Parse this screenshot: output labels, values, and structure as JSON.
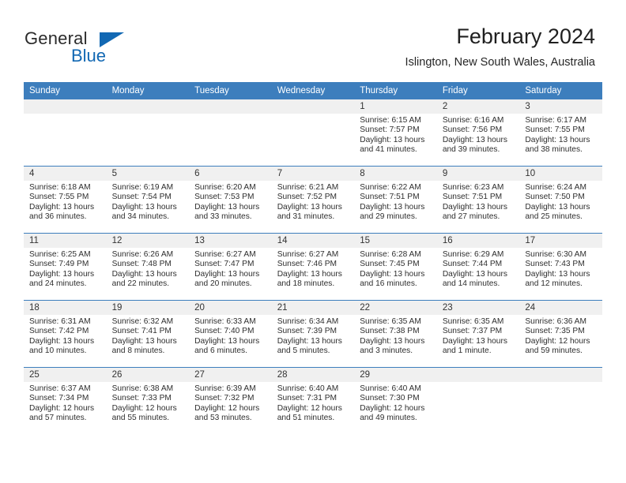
{
  "brand": {
    "name_part1": "General",
    "name_part2": "Blue",
    "accent_color": "#1268b3"
  },
  "header": {
    "title": "February 2024",
    "location": "Islington, New South Wales, Australia"
  },
  "theme": {
    "header_row_bg": "#3d7ebd",
    "daynum_bg": "#f0f0f0",
    "grid_line": "#3d7ebd"
  },
  "weekday_headers": [
    "Sunday",
    "Monday",
    "Tuesday",
    "Wednesday",
    "Thursday",
    "Friday",
    "Saturday"
  ],
  "weeks": [
    [
      {
        "day": "",
        "sunrise": "",
        "sunset": "",
        "daylight": "",
        "daylight2": ""
      },
      {
        "day": "",
        "sunrise": "",
        "sunset": "",
        "daylight": "",
        "daylight2": ""
      },
      {
        "day": "",
        "sunrise": "",
        "sunset": "",
        "daylight": "",
        "daylight2": ""
      },
      {
        "day": "",
        "sunrise": "",
        "sunset": "",
        "daylight": "",
        "daylight2": ""
      },
      {
        "day": "1",
        "sunrise": "Sunrise: 6:15 AM",
        "sunset": "Sunset: 7:57 PM",
        "daylight": "Daylight: 13 hours",
        "daylight2": "and 41 minutes."
      },
      {
        "day": "2",
        "sunrise": "Sunrise: 6:16 AM",
        "sunset": "Sunset: 7:56 PM",
        "daylight": "Daylight: 13 hours",
        "daylight2": "and 39 minutes."
      },
      {
        "day": "3",
        "sunrise": "Sunrise: 6:17 AM",
        "sunset": "Sunset: 7:55 PM",
        "daylight": "Daylight: 13 hours",
        "daylight2": "and 38 minutes."
      }
    ],
    [
      {
        "day": "4",
        "sunrise": "Sunrise: 6:18 AM",
        "sunset": "Sunset: 7:55 PM",
        "daylight": "Daylight: 13 hours",
        "daylight2": "and 36 minutes."
      },
      {
        "day": "5",
        "sunrise": "Sunrise: 6:19 AM",
        "sunset": "Sunset: 7:54 PM",
        "daylight": "Daylight: 13 hours",
        "daylight2": "and 34 minutes."
      },
      {
        "day": "6",
        "sunrise": "Sunrise: 6:20 AM",
        "sunset": "Sunset: 7:53 PM",
        "daylight": "Daylight: 13 hours",
        "daylight2": "and 33 minutes."
      },
      {
        "day": "7",
        "sunrise": "Sunrise: 6:21 AM",
        "sunset": "Sunset: 7:52 PM",
        "daylight": "Daylight: 13 hours",
        "daylight2": "and 31 minutes."
      },
      {
        "day": "8",
        "sunrise": "Sunrise: 6:22 AM",
        "sunset": "Sunset: 7:51 PM",
        "daylight": "Daylight: 13 hours",
        "daylight2": "and 29 minutes."
      },
      {
        "day": "9",
        "sunrise": "Sunrise: 6:23 AM",
        "sunset": "Sunset: 7:51 PM",
        "daylight": "Daylight: 13 hours",
        "daylight2": "and 27 minutes."
      },
      {
        "day": "10",
        "sunrise": "Sunrise: 6:24 AM",
        "sunset": "Sunset: 7:50 PM",
        "daylight": "Daylight: 13 hours",
        "daylight2": "and 25 minutes."
      }
    ],
    [
      {
        "day": "11",
        "sunrise": "Sunrise: 6:25 AM",
        "sunset": "Sunset: 7:49 PM",
        "daylight": "Daylight: 13 hours",
        "daylight2": "and 24 minutes."
      },
      {
        "day": "12",
        "sunrise": "Sunrise: 6:26 AM",
        "sunset": "Sunset: 7:48 PM",
        "daylight": "Daylight: 13 hours",
        "daylight2": "and 22 minutes."
      },
      {
        "day": "13",
        "sunrise": "Sunrise: 6:27 AM",
        "sunset": "Sunset: 7:47 PM",
        "daylight": "Daylight: 13 hours",
        "daylight2": "and 20 minutes."
      },
      {
        "day": "14",
        "sunrise": "Sunrise: 6:27 AM",
        "sunset": "Sunset: 7:46 PM",
        "daylight": "Daylight: 13 hours",
        "daylight2": "and 18 minutes."
      },
      {
        "day": "15",
        "sunrise": "Sunrise: 6:28 AM",
        "sunset": "Sunset: 7:45 PM",
        "daylight": "Daylight: 13 hours",
        "daylight2": "and 16 minutes."
      },
      {
        "day": "16",
        "sunrise": "Sunrise: 6:29 AM",
        "sunset": "Sunset: 7:44 PM",
        "daylight": "Daylight: 13 hours",
        "daylight2": "and 14 minutes."
      },
      {
        "day": "17",
        "sunrise": "Sunrise: 6:30 AM",
        "sunset": "Sunset: 7:43 PM",
        "daylight": "Daylight: 13 hours",
        "daylight2": "and 12 minutes."
      }
    ],
    [
      {
        "day": "18",
        "sunrise": "Sunrise: 6:31 AM",
        "sunset": "Sunset: 7:42 PM",
        "daylight": "Daylight: 13 hours",
        "daylight2": "and 10 minutes."
      },
      {
        "day": "19",
        "sunrise": "Sunrise: 6:32 AM",
        "sunset": "Sunset: 7:41 PM",
        "daylight": "Daylight: 13 hours",
        "daylight2": "and 8 minutes."
      },
      {
        "day": "20",
        "sunrise": "Sunrise: 6:33 AM",
        "sunset": "Sunset: 7:40 PM",
        "daylight": "Daylight: 13 hours",
        "daylight2": "and 6 minutes."
      },
      {
        "day": "21",
        "sunrise": "Sunrise: 6:34 AM",
        "sunset": "Sunset: 7:39 PM",
        "daylight": "Daylight: 13 hours",
        "daylight2": "and 5 minutes."
      },
      {
        "day": "22",
        "sunrise": "Sunrise: 6:35 AM",
        "sunset": "Sunset: 7:38 PM",
        "daylight": "Daylight: 13 hours",
        "daylight2": "and 3 minutes."
      },
      {
        "day": "23",
        "sunrise": "Sunrise: 6:35 AM",
        "sunset": "Sunset: 7:37 PM",
        "daylight": "Daylight: 13 hours",
        "daylight2": "and 1 minute."
      },
      {
        "day": "24",
        "sunrise": "Sunrise: 6:36 AM",
        "sunset": "Sunset: 7:35 PM",
        "daylight": "Daylight: 12 hours",
        "daylight2": "and 59 minutes."
      }
    ],
    [
      {
        "day": "25",
        "sunrise": "Sunrise: 6:37 AM",
        "sunset": "Sunset: 7:34 PM",
        "daylight": "Daylight: 12 hours",
        "daylight2": "and 57 minutes."
      },
      {
        "day": "26",
        "sunrise": "Sunrise: 6:38 AM",
        "sunset": "Sunset: 7:33 PM",
        "daylight": "Daylight: 12 hours",
        "daylight2": "and 55 minutes."
      },
      {
        "day": "27",
        "sunrise": "Sunrise: 6:39 AM",
        "sunset": "Sunset: 7:32 PM",
        "daylight": "Daylight: 12 hours",
        "daylight2": "and 53 minutes."
      },
      {
        "day": "28",
        "sunrise": "Sunrise: 6:40 AM",
        "sunset": "Sunset: 7:31 PM",
        "daylight": "Daylight: 12 hours",
        "daylight2": "and 51 minutes."
      },
      {
        "day": "29",
        "sunrise": "Sunrise: 6:40 AM",
        "sunset": "Sunset: 7:30 PM",
        "daylight": "Daylight: 12 hours",
        "daylight2": "and 49 minutes."
      },
      {
        "day": "",
        "sunrise": "",
        "sunset": "",
        "daylight": "",
        "daylight2": ""
      },
      {
        "day": "",
        "sunrise": "",
        "sunset": "",
        "daylight": "",
        "daylight2": ""
      }
    ]
  ]
}
